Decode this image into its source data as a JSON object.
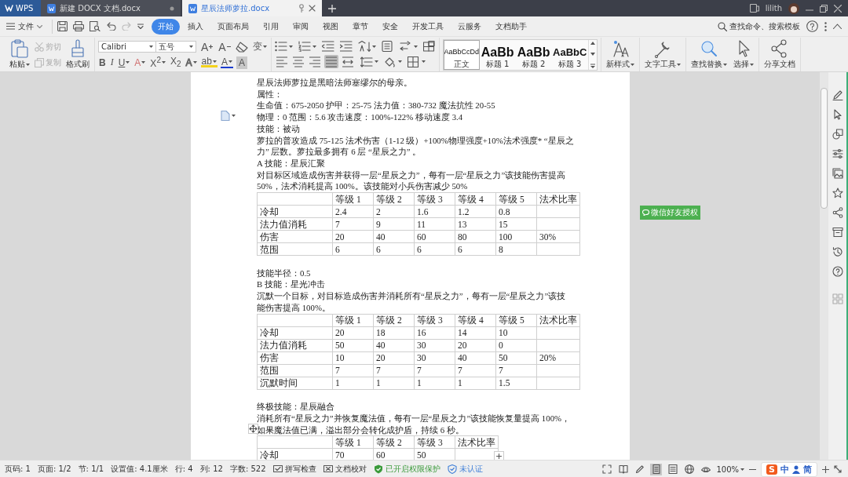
{
  "title_bar": {
    "app": "WPS",
    "tabs": [
      {
        "title": "新建 DOCX 文档.docx",
        "selected": false
      },
      {
        "title": "星辰法师萝拉.docx",
        "selected": true
      }
    ],
    "user": "lilith"
  },
  "menu_bar": {
    "file": "文件",
    "tabs": [
      {
        "label": "开始",
        "selected": true
      },
      {
        "label": "插入",
        "selected": false
      },
      {
        "label": "页面布局",
        "selected": false
      },
      {
        "label": "引用",
        "selected": false
      },
      {
        "label": "审阅",
        "selected": false
      },
      {
        "label": "视图",
        "selected": false
      },
      {
        "label": "章节",
        "selected": false
      },
      {
        "label": "安全",
        "selected": false
      },
      {
        "label": "开发工具",
        "selected": false
      },
      {
        "label": "云服务",
        "selected": false
      },
      {
        "label": "文档助手",
        "selected": false
      }
    ],
    "search": "查找命令、搜索模板"
  },
  "ribbon": {
    "paste": "粘贴",
    "cut": {
      "label": "剪切",
      "disabled": true
    },
    "copy": {
      "label": "复制",
      "disabled": true
    },
    "format_painter": "格式刷",
    "font": "Calibri",
    "size": "五号",
    "font_tools": [
      {
        "kind": "grow",
        "label": "A"
      },
      {
        "kind": "shrink",
        "label": "A"
      },
      {
        "kind": "clear"
      },
      {
        "kind": "phonetic",
        "label": "变"
      }
    ],
    "format_buttons": [
      {
        "kind": "bold",
        "label": "B",
        "dropdown": false
      },
      {
        "kind": "italic",
        "label": "I",
        "dropdown": false
      },
      {
        "kind": "underline",
        "label": "U",
        "dropdown": true
      },
      {
        "kind": "strike",
        "label": "A",
        "dropdown": true
      },
      {
        "kind": "superscript",
        "label": "X$^{2}$",
        "dropdown": true
      },
      {
        "kind": "subscript",
        "label": "X$_{2}$",
        "dropdown": false
      },
      {
        "kind": "effect",
        "label": "A",
        "dropdown": true
      },
      {
        "kind": "highlight",
        "label": "ab",
        "dropdown": true
      },
      {
        "kind": "color",
        "label": "A",
        "dropdown": true
      },
      {
        "kind": "shade",
        "label": "A",
        "dropdown": false
      }
    ],
    "alignments": [
      {
        "kind": "left",
        "selected": false
      },
      {
        "kind": "center",
        "selected": false
      },
      {
        "kind": "right",
        "selected": false
      },
      {
        "kind": "justify",
        "selected": true
      },
      {
        "kind": "distributed",
        "selected": false
      }
    ],
    "styles": [
      {
        "preview": "AaBbCcDd",
        "label": "正文",
        "selected": true
      },
      {
        "preview": "AaBb",
        "label": "标题 1",
        "selected": false
      },
      {
        "preview": "AaBb",
        "label": "标题 2",
        "selected": false
      },
      {
        "preview": "AaBbC",
        "label": "标题 3",
        "selected": false
      }
    ],
    "tools": [
      {
        "kind": "new_style",
        "label": "新样式",
        "dropdown": true
      },
      {
        "kind": "text_tools",
        "label": "文字工具",
        "dropdown": true
      },
      {
        "kind": "find_replace",
        "label": "查找替换",
        "dropdown": true
      },
      {
        "kind": "select",
        "label": "选择",
        "dropdown": true
      },
      {
        "kind": "share",
        "label": "分享文档",
        "dropdown": false
      }
    ]
  },
  "document": {
    "blocks": [
      {
        "kind": "para",
        "text": "星辰法师萝拉是黑暗法师塞缪尔的母亲。"
      },
      {
        "kind": "para",
        "text": "属性："
      },
      {
        "kind": "para",
        "text": "生命值：675-2050 护甲：25-75 法力值：380-732 魔法抗性 20-55"
      },
      {
        "kind": "para",
        "text": "物理：0  范围：5.6 攻击速度：100%-122% 移动速度 3.4"
      },
      {
        "kind": "para",
        "text": "技能：被动"
      },
      {
        "kind": "para",
        "text": "萝拉的普攻造成 75-125 法术伤害（1-12 级）+100%物理强度+10%法术强度* “星辰之力” 层数。萝拉最多拥有 6 层 “星辰之力” 。"
      },
      {
        "kind": "para",
        "text": "A 技能：星辰汇聚"
      },
      {
        "kind": "para",
        "text": "对目标区域造成伤害并获得一层“星辰之力”，每有一层“星辰之力”该技能伤害提高 50%，法术消耗提高 100%。该技能对小兵伤害减少 50%"
      },
      {
        "kind": "table",
        "rows": [
          [
            "",
            "等级 1",
            "等级 2",
            "等级 3",
            "等级 4",
            "等级 5",
            "法术比率"
          ],
          [
            "冷却",
            "2.4",
            "2",
            "1.6",
            "1.2",
            "0.8",
            ""
          ],
          [
            "法力值消耗",
            "7",
            "9",
            "11",
            "13",
            "15",
            ""
          ],
          [
            "伤害",
            "20",
            "40",
            "60",
            "80",
            "100",
            "30%"
          ],
          [
            "范围",
            "6",
            "6",
            "6",
            "6",
            "8",
            ""
          ]
        ]
      },
      {
        "kind": "blank"
      },
      {
        "kind": "para",
        "text": "技能半径：0.5"
      },
      {
        "kind": "para",
        "text": "B 技能：星光冲击"
      },
      {
        "kind": "para",
        "text": "沉默一个目标，对目标造成伤害并消耗所有“星辰之力”，每有一层“星辰之力”该技能伤害提高 100%。"
      },
      {
        "kind": "table",
        "rows": [
          [
            "",
            "等级 1",
            "等级 2",
            "等级 3",
            "等级 4",
            "等级 5",
            "法术比率"
          ],
          [
            "冷却",
            "20",
            "18",
            "16",
            "14",
            "10",
            ""
          ],
          [
            "法力值消耗",
            "50",
            "40",
            "30",
            "20",
            "0",
            ""
          ],
          [
            "伤害",
            "10",
            "20",
            "30",
            "40",
            "50",
            "20%"
          ],
          [
            "范围",
            "7",
            "7",
            "7",
            "7",
            "7",
            ""
          ],
          [
            "沉默时间",
            "1",
            "1",
            "1",
            "1",
            "1.5",
            ""
          ]
        ]
      },
      {
        "kind": "blank"
      },
      {
        "kind": "para",
        "text": "终极技能：星辰融合"
      },
      {
        "kind": "para",
        "text": "消耗所有“星辰之力”并恢复魔法值，每有一层“星辰之力”该技能恢复量提高 100%，如果魔法值已满，溢出部分会转化成护盾，持续 6 秒。"
      },
      {
        "kind": "table",
        "rows": [
          [
            "",
            "等级 1",
            "等级 2",
            "等级 3",
            "法术比率"
          ],
          [
            "冷却",
            "70",
            "60",
            "50",
            ""
          ]
        ]
      }
    ]
  },
  "badge": "微信好友授权",
  "status_bar": {
    "items": [
      {
        "kind": "text",
        "text": "页码: 1"
      },
      {
        "kind": "text",
        "text": "页面: 1/2"
      },
      {
        "kind": "text",
        "text": "节: 1/1"
      },
      {
        "kind": "text",
        "text": "设置值: 4.1厘米"
      },
      {
        "kind": "text",
        "text": "行: 4"
      },
      {
        "kind": "text",
        "text": "列: 12"
      },
      {
        "kind": "text",
        "text": "字数: 522"
      },
      {
        "kind": "check",
        "text": "拼写检查"
      },
      {
        "kind": "proof",
        "text": "文档校对"
      },
      {
        "kind": "protected",
        "text": "已开启权限保护"
      },
      {
        "kind": "certify",
        "text": "未认证"
      }
    ],
    "view_modes": [
      {
        "kind": "fullscreen",
        "selected": false
      },
      {
        "kind": "reading",
        "selected": false
      },
      {
        "kind": "pen",
        "selected": false
      },
      {
        "kind": "page",
        "selected": true
      },
      {
        "kind": "outline",
        "selected": false
      },
      {
        "kind": "web",
        "selected": false
      },
      {
        "kind": "eye",
        "selected": false
      }
    ],
    "zoom": "100%",
    "ime": {
      "logo": "S",
      "language": "中",
      "mode": "简"
    }
  }
}
